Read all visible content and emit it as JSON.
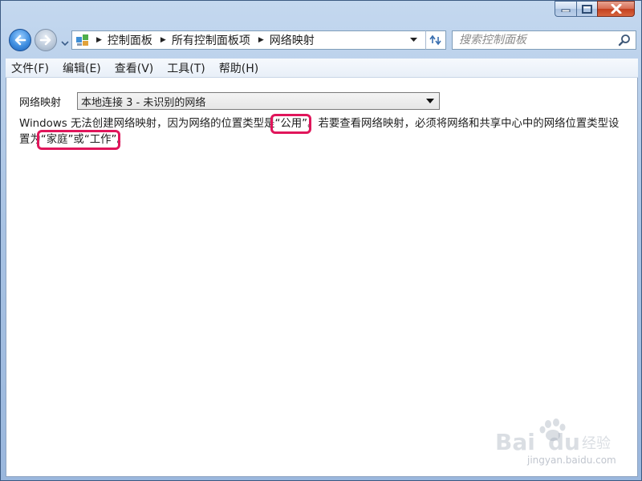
{
  "window": {
    "caption_buttons": [
      "minimize",
      "maximize",
      "close"
    ]
  },
  "navigation": {
    "breadcrumb": [
      "控制面板",
      "所有控制面板项",
      "网络映射"
    ],
    "search_placeholder": "搜索控制面板"
  },
  "menu": {
    "items": [
      "文件(F)",
      "编辑(E)",
      "查看(V)",
      "工具(T)",
      "帮助(H)"
    ]
  },
  "content": {
    "label": "网络映射",
    "network_select_value": "本地连接 3 - 未识别的网络",
    "message_parts": [
      "Windows 无法创建网络映射，因为网络的位置类型是",
      "“公用”",
      "。若要查看网络映射，必须将网络和共享中心中的网络位置类型设置为",
      "“家庭”或“工作”",
      "。"
    ]
  },
  "watermark": {
    "text": "jingyan.baidu.com"
  },
  "colors": {
    "highlight": "#e0165b",
    "frame": "#a9c3e3"
  },
  "icons": [
    "back-arrow-icon",
    "forward-arrow-icon",
    "control-panel-icon",
    "dropdown-icon",
    "refresh-icon",
    "search-icon",
    "minimize-icon",
    "maximize-icon",
    "close-icon"
  ]
}
